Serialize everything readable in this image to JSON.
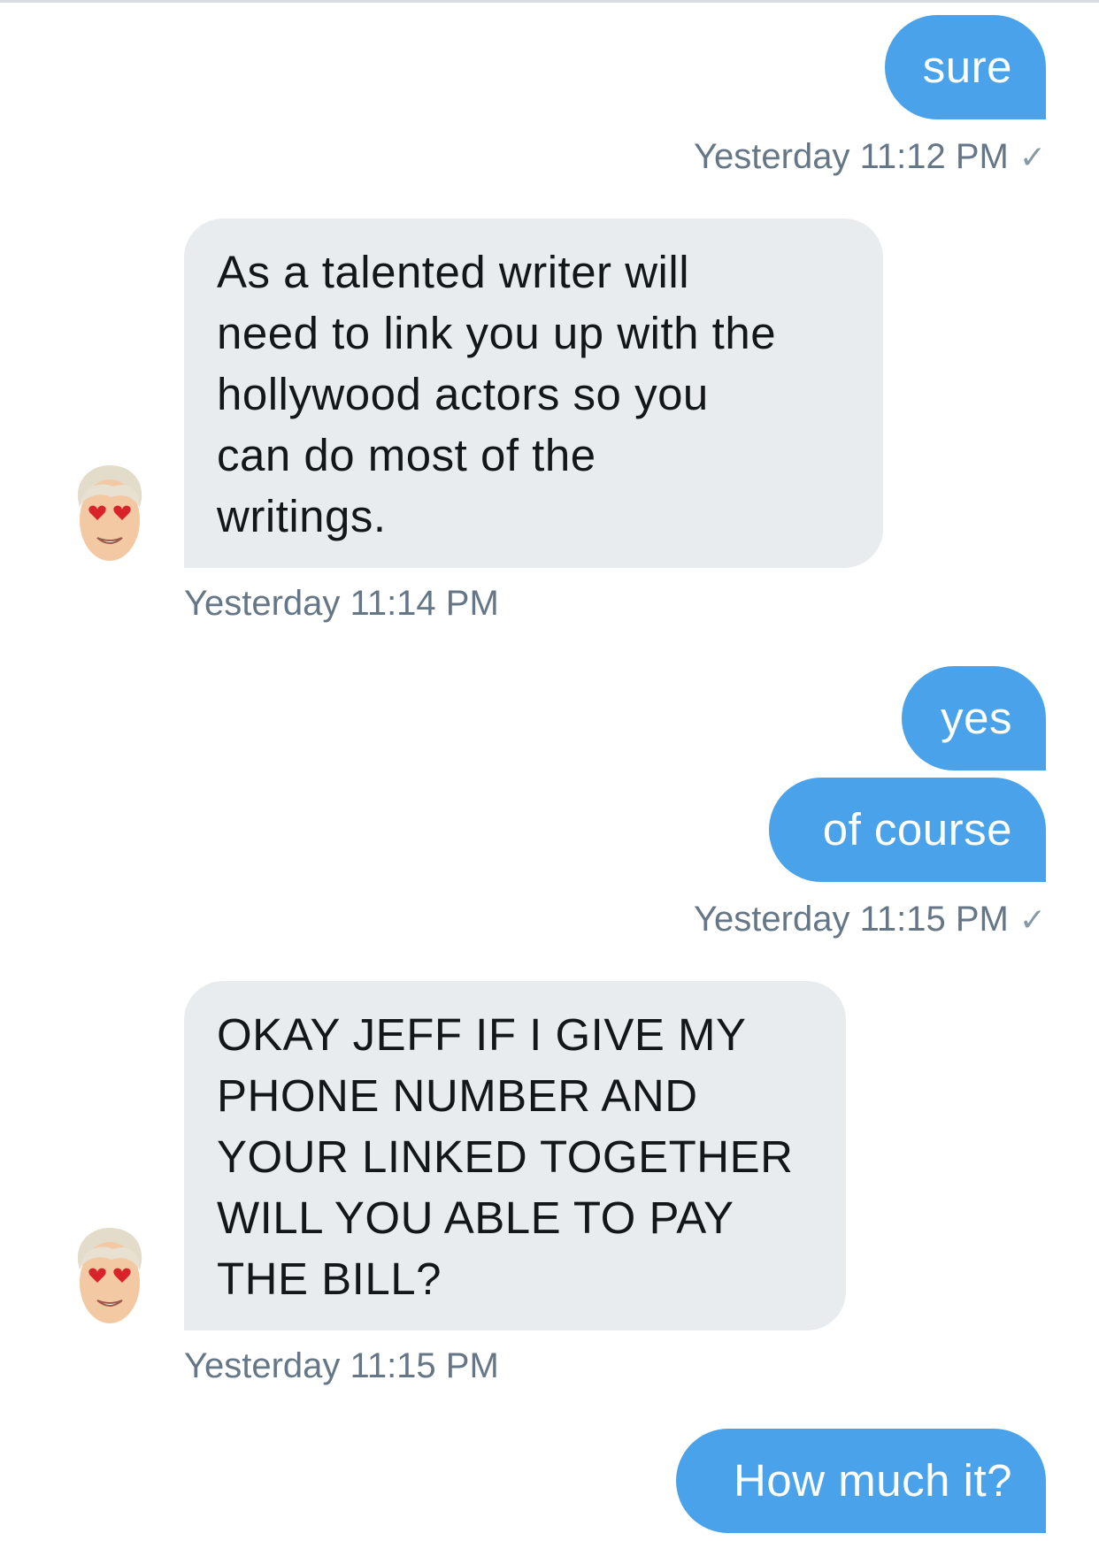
{
  "conversation": {
    "msg1": {
      "text": "sure"
    },
    "ts1": {
      "text": "Yesterday 11:12 PM"
    },
    "msg2": {
      "lines": [
        "As a talented writer will",
        "need to link you up with the",
        "hollywood actors so you",
        "can do most of the",
        "writings."
      ]
    },
    "ts2": {
      "text": "Yesterday 11:14 PM"
    },
    "msg3": {
      "text": "yes"
    },
    "msg4": {
      "text": "of course"
    },
    "ts3": {
      "text": "Yesterday 11:15 PM"
    },
    "msg5": {
      "lines": [
        "OKAY JEFF  IF I GIVE MY",
        "PHONE NUMBER AND",
        "YOUR LINKED TOGETHER",
        "WILL YOU ABLE TO PAY",
        "THE BILL?"
      ]
    },
    "ts4": {
      "text": "Yesterday 11:15 PM"
    },
    "msg6": {
      "text": "How much it?"
    }
  },
  "colors": {
    "outgoing_bubble": "#4aa3ea",
    "incoming_bubble": "#e8ecef",
    "timestamp_text": "#657786"
  },
  "icons": {
    "read_receipt": "check-icon",
    "avatar": "avatar-icon"
  }
}
